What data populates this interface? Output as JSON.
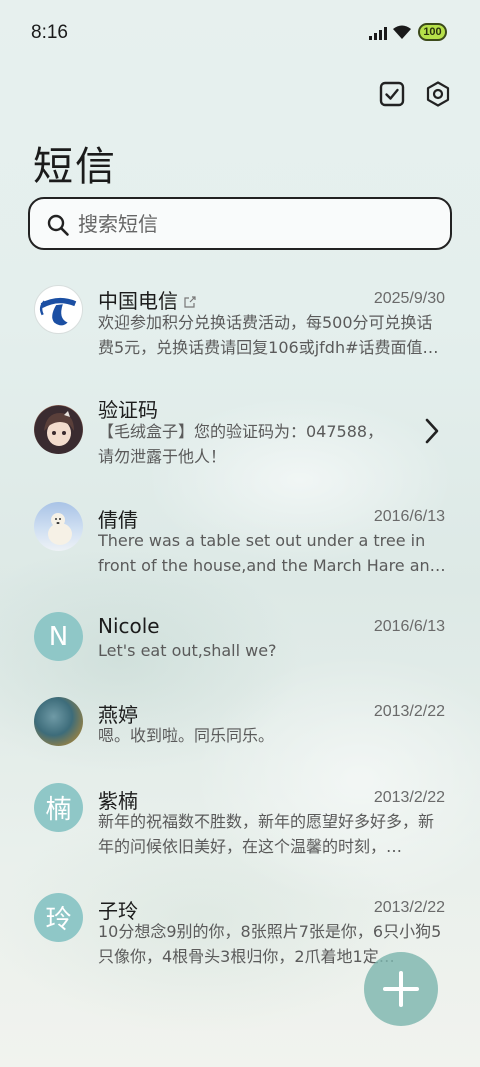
{
  "status_bar": {
    "time": "8:16",
    "battery": "100"
  },
  "header": {
    "title": "短信"
  },
  "search": {
    "placeholder": "搜索短信"
  },
  "conversations": [
    {
      "name": "中国电信",
      "date": "2025/9/30",
      "preview": "欢迎参加积分兑换话费活动，每500分可兑换话费5元，兑换话费请回复106或jfdh#话费面值…",
      "avatar": "china-telecom-logo"
    },
    {
      "name": "验证码",
      "date": "",
      "preview": "【毛绒盒子】您的验证码为：047588，请勿泄露于他人！",
      "avatar": "anime-girl-avatar"
    },
    {
      "name": "倩倩",
      "date": "2016/6/13",
      "preview": "There was a table set out under a tree in front of the house,and the March Hare and the Hatter…",
      "avatar": "polar-bear-avatar"
    },
    {
      "name": "Nicole",
      "date": "2016/6/13",
      "preview": "Let's eat out,shall we?",
      "avatar_letter": "N"
    },
    {
      "name": "燕婷",
      "date": "2013/2/22",
      "preview": "嗯。收到啦。同乐同乐。",
      "avatar": "landscape-avatar"
    },
    {
      "name": "紫楠",
      "date": "2013/2/22",
      "preview": "新年的祝福数不胜数，新年的愿望好多好多，新年的问候依旧美好，在这个温馨的时刻，…",
      "avatar_letter": "楠"
    },
    {
      "name": "子玲",
      "date": "2013/2/22",
      "preview": "10分想念9别的你，8张照片7张是你，6只小狗5只像你，4根骨头3根归你，2爪着地1定…",
      "avatar_letter": "玲"
    }
  ],
  "colors": {
    "accent": "#8fc7c7",
    "fab": "#7eb6ae",
    "telecom_blue": "#1b4fa3"
  },
  "icons": {
    "select": "checkbox-icon",
    "settings": "settings-hexagon-icon",
    "search": "search-icon",
    "fab": "plus-icon"
  }
}
